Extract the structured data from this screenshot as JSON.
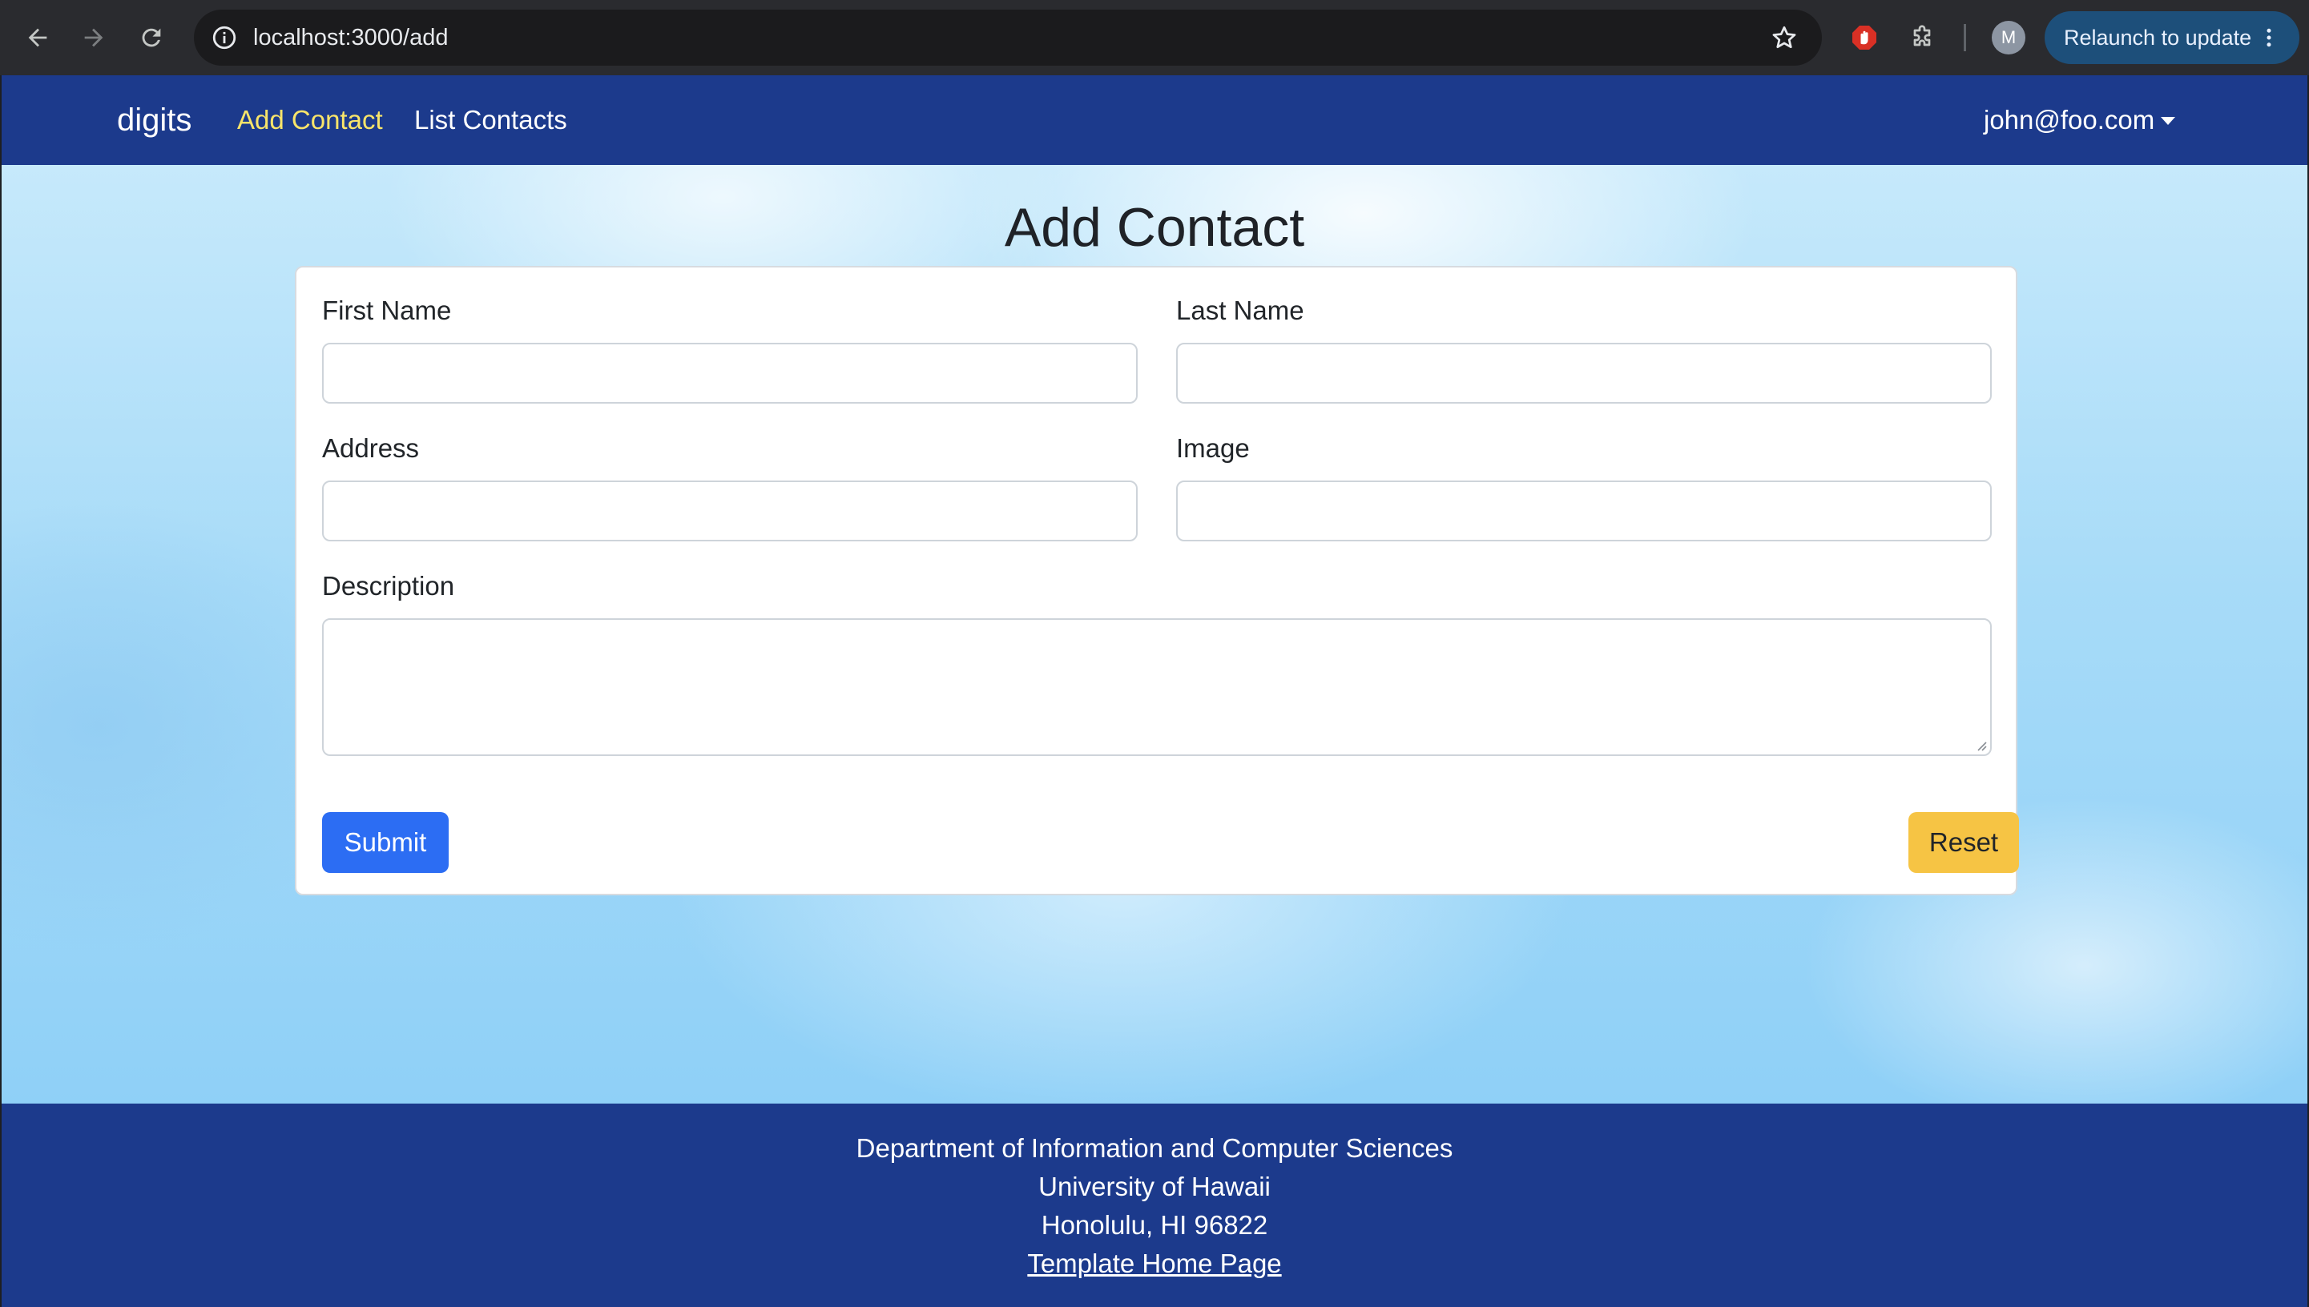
{
  "browser": {
    "url": "localhost:3000/add",
    "profile_initial": "M",
    "relaunch_label": "Relaunch to update"
  },
  "navbar": {
    "brand": "digits",
    "links": [
      {
        "label": "Add Contact",
        "active": true
      },
      {
        "label": "List Contacts",
        "active": false
      }
    ],
    "user": "john@foo.com"
  },
  "page": {
    "title": "Add Contact"
  },
  "form": {
    "first_name": {
      "label": "First Name",
      "value": ""
    },
    "last_name": {
      "label": "Last Name",
      "value": ""
    },
    "address": {
      "label": "Address",
      "value": ""
    },
    "image": {
      "label": "Image",
      "value": ""
    },
    "description": {
      "label": "Description",
      "value": ""
    },
    "submit_label": "Submit",
    "reset_label": "Reset"
  },
  "footer": {
    "lines": [
      "Department of Information and Computer Sciences",
      "University of Hawaii",
      "Honolulu, HI 96822"
    ],
    "link": "Template Home Page"
  },
  "colors": {
    "navbar": "#1c3a8c",
    "active_link": "#f8e46a",
    "submit": "#2c6df3",
    "reset": "#f6c444"
  }
}
